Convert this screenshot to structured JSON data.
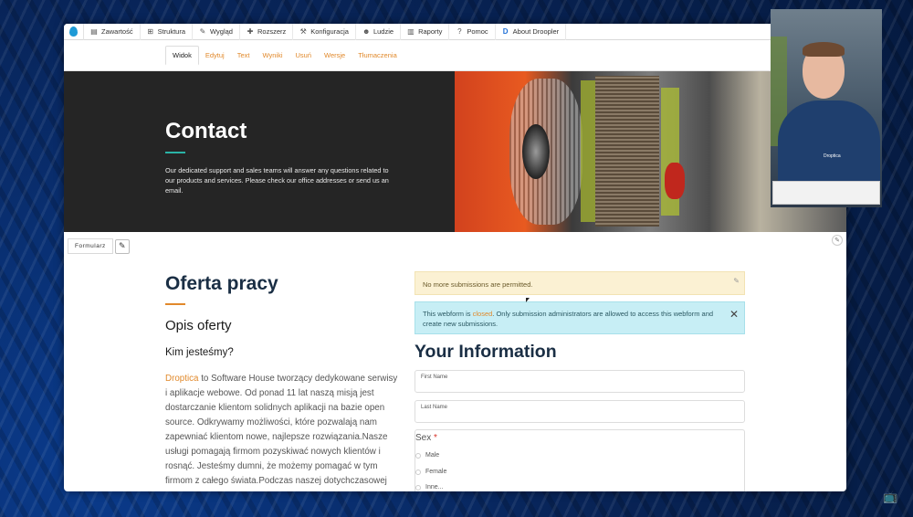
{
  "toolbar": {
    "items": [
      {
        "label": "Zawartość",
        "icon": "document-icon"
      },
      {
        "label": "Struktura",
        "icon": "sitemap-icon"
      },
      {
        "label": "Wygląd",
        "icon": "brush-icon"
      },
      {
        "label": "Rozszerz",
        "icon": "puzzle-icon"
      },
      {
        "label": "Konfiguracja",
        "icon": "wrench-icon"
      },
      {
        "label": "Ludzie",
        "icon": "people-icon"
      },
      {
        "label": "Raporty",
        "icon": "bar-chart-icon"
      },
      {
        "label": "Pomoc",
        "icon": "help-icon"
      },
      {
        "label": "About Droopler",
        "icon": "droopler-icon"
      }
    ]
  },
  "tabs": [
    "Widok",
    "Edytuj",
    "Text",
    "Wyniki",
    "Usuń",
    "Wersje",
    "Tłumaczenia"
  ],
  "hero": {
    "title": "Contact",
    "description": "Our dedicated support and sales teams will answer any questions related to our products and services. Please check our office addresses or send us an email."
  },
  "block": {
    "label": "Formularz"
  },
  "job": {
    "title": "Oferta pracy",
    "subtitle": "Opis oferty",
    "who": "Kim jesteśmy?",
    "body_link": "Droptica",
    "body": " to Software House tworzący dedykowane serwisy i aplikacje webowe. Od ponad 11 lat naszą misją jest dostarczanie klientom solidnych aplikacji na bazie open source. Odkrywamy możliwości, które pozwalają nam zapewniać klientom nowe, najlepsze rozwiązania.Nasze usługi pomagają firmom pozyskiwać nowych klientów i rosnąć. Jesteśmy dumni, że możemy pomagać w tym firmom z całego świata.Podczas naszej dotychczasowej"
  },
  "messages": {
    "warning": "No more submissions are permitted.",
    "info_prefix": "This webform is ",
    "info_closed": "closed",
    "info_suffix": ". Only submission administrators are allowed to access this webform and create new submissions."
  },
  "form": {
    "title": "Your Information",
    "first_name_label": "First Name",
    "last_name_label": "Last Name",
    "sex_label": "Sex",
    "required_mark": "*",
    "options": [
      "Male",
      "Female",
      "Inne..."
    ]
  },
  "webcam": {
    "shirt_text": "Droptica"
  },
  "colors": {
    "accent": "#e1892b",
    "teal": "#2ab3a6",
    "heading": "#1a2e44",
    "info_bg": "#c7eef5",
    "warn_bg": "#fbf1d3"
  }
}
